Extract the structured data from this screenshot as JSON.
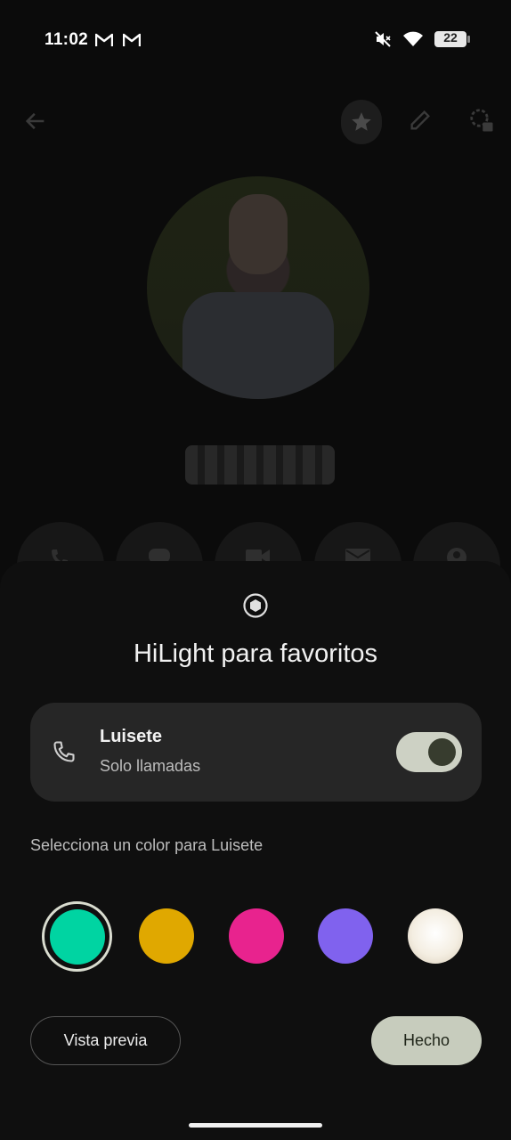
{
  "status_bar": {
    "time": "11:02",
    "notification_icons": [
      "gmail-icon",
      "gmail-icon"
    ],
    "system_icons": [
      "mute-icon",
      "wifi-icon"
    ],
    "battery_level": "22"
  },
  "background_screen": {
    "toolbar_icons": [
      "back-arrow-icon",
      "star-icon",
      "edit-pencil-icon",
      "contact-settings-icon"
    ],
    "action_icons": [
      "phone-icon",
      "message-icon",
      "video-icon",
      "email-icon",
      "profile-icon"
    ]
  },
  "sheet": {
    "icon": "hilight-badge-icon",
    "title": "HiLight para favoritos",
    "contact": {
      "name": "Luisete",
      "subtitle": "Solo llamadas",
      "toggle_on": true
    },
    "color_prompt": "Selecciona un color para Luisete",
    "colors": [
      {
        "name": "green",
        "hex": "#00d4a2",
        "selected": true
      },
      {
        "name": "yellow",
        "hex": "#e0a800",
        "selected": false
      },
      {
        "name": "pink",
        "hex": "#e8238e",
        "selected": false
      },
      {
        "name": "purple",
        "hex": "#8062ee",
        "selected": false
      },
      {
        "name": "white",
        "hex": "#f4eee2",
        "selected": false
      }
    ],
    "preview_button": "Vista previa",
    "done_button": "Hecho"
  }
}
